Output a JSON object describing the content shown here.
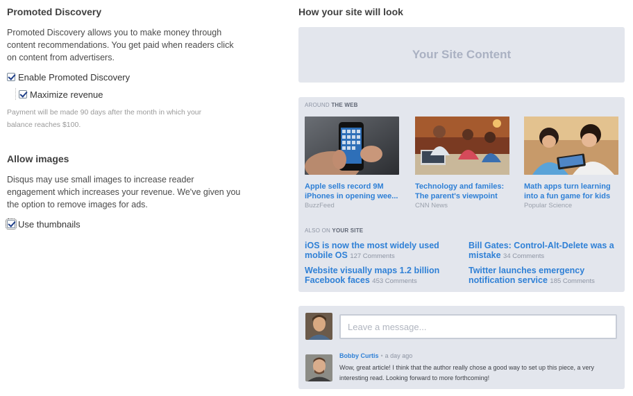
{
  "promoted": {
    "heading": "Promoted Discovery",
    "description": "Promoted Discovery allows you to make money through content recommendations. You get paid when readers click on content from advertisers.",
    "enable_label": "Enable Promoted Discovery",
    "maximize_label": "Maximize revenue",
    "payment_note": "Payment will be made 90 days after the month in which your balance reaches $100."
  },
  "images": {
    "heading": "Allow images",
    "description": "Disqus may use small images to increase reader engagement which increases your revenue. We've given you the option to remove images for ads.",
    "thumbnails_label": "Use thumbnails"
  },
  "preview": {
    "heading": "How your site will look",
    "site_content": "Your Site Content",
    "around_prefix": "AROUND",
    "around_bold": "THE WEB",
    "cards": [
      {
        "title": "Apple sells record 9M iPhones in opening wee...",
        "source": "BuzzFeed"
      },
      {
        "title": "Technology and familes: The parent's viewpoint",
        "source": "CNN News"
      },
      {
        "title": "Math apps turn learning into a fun game for kids",
        "source": "Popular Science"
      }
    ],
    "also_prefix": "ALSO ON",
    "also_bold": "YOUR SITE",
    "site_links": [
      {
        "title": "iOS is now the most widely used mobile OS",
        "comments": "127 Comments"
      },
      {
        "title": "Bill Gates: Control-Alt-Delete was a mistake",
        "comments": "34 Comments"
      },
      {
        "title": "Website visually maps 1.2 billion Facebook faces",
        "comments": "453 Comments"
      },
      {
        "title": "Twitter launches emergency notification service",
        "comments": "185 Comments"
      }
    ],
    "message_placeholder": "Leave a message...",
    "comment": {
      "author": "Bobby Curtis",
      "separator": "•",
      "time": "a day ago",
      "text": "Wow, great article!  I think that the author really chose a good way to set up this piece, a very interesting read.  Looking forward to more forthcoming!"
    }
  },
  "colors": {
    "link": "#2f80d6",
    "panel": "#e3e6ed",
    "checkbox_mark": "#1f3f8a"
  }
}
